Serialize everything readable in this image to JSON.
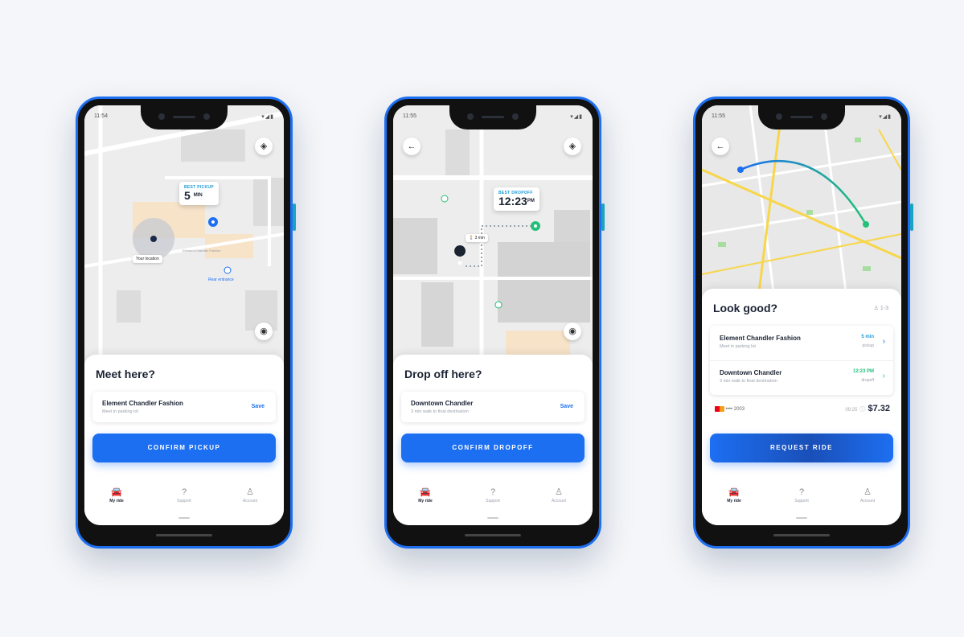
{
  "status": {
    "time1": "11:54",
    "time2": "11:55",
    "time3": "11:55",
    "icons": "▾◢▮"
  },
  "phone1": {
    "eta_label": "BEST PICKUP",
    "eta_value": "5",
    "eta_unit": "MIN",
    "your_location": "Your location",
    "poi_label": "Element Chandler Fashion",
    "rear_entrance": "Rear entrance",
    "title": "Meet here?",
    "card_title": "Element Chandler Fashion",
    "card_sub": "Meet in parking lot",
    "save": "Save",
    "cta": "CONFIRM PICKUP"
  },
  "phone2": {
    "eta_label": "BEST DROPOFF",
    "eta_value": "12:23",
    "eta_unit": "PM",
    "walk_tag": "3 min",
    "title": "Drop off here?",
    "card_title": "Downtown Chandler",
    "card_sub": "3 min walk to final destination",
    "save": "Save",
    "cta": "CONFIRM DROPOFF"
  },
  "phone3": {
    "title": "Look good?",
    "riders": "1-3",
    "row1_title": "Element Chandler Fashion",
    "row1_sub": "Meet in parking lot",
    "row1_time": "5 min",
    "row1_meta": "pickup",
    "row2_title": "Downtown Chandler",
    "row2_sub": "3 min walk to final destination",
    "row2_time": "12:23 PM",
    "row2_meta": "dropoff",
    "card_digits": "•••• 2003",
    "eta_time": "09:25",
    "price": "$7.32",
    "cta": "REQUEST RIDE"
  },
  "nav": {
    "my_ride": "My ride",
    "support": "Support",
    "account": "Account"
  },
  "colors": {
    "accent": "#1d6ff2",
    "green": "#22c07a",
    "route_yellow": "#f7d64a",
    "bg": "#f4f6f9"
  }
}
